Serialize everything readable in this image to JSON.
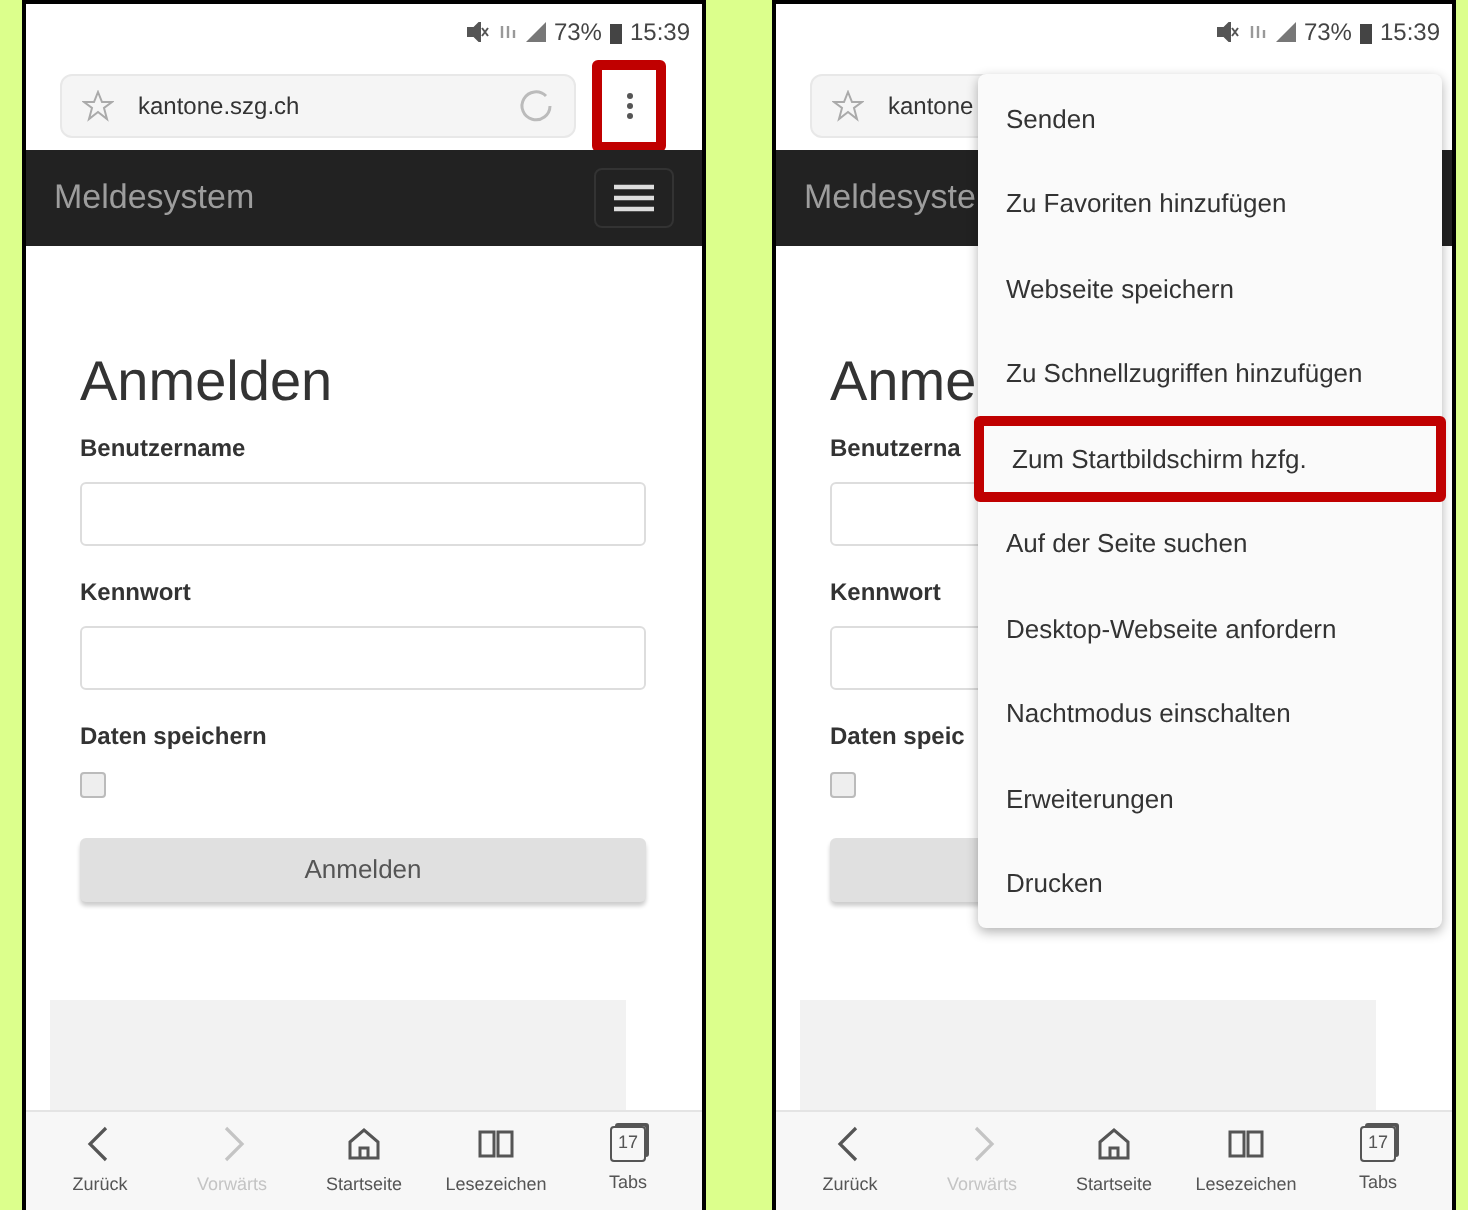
{
  "screens": [
    {
      "status": {
        "battery": "73%",
        "time": "15:39"
      },
      "address_bar": {
        "url": "kantone.szg.ch",
        "menu_button": {
          "highlighted": true
        }
      },
      "navbar": {
        "title": "Meldesystem",
        "menu_toggle": true
      },
      "login": {
        "heading": "Anmelden",
        "fields": [
          {
            "label": "Benutzername"
          },
          {
            "label": "Kennwort"
          }
        ],
        "checkbox": {
          "label": "Daten speichern",
          "checked": false
        },
        "button": {
          "label": "Anmelden"
        }
      },
      "bottom_nav": [
        {
          "label": "Zurück",
          "disabled": false
        },
        {
          "label": "Vorwärts",
          "disabled": true
        },
        {
          "label": "Startseite",
          "disabled": false
        },
        {
          "label": "Lesezeichen",
          "disabled": false
        },
        {
          "label": "Tabs",
          "badge": "17",
          "disabled": false
        }
      ]
    },
    {
      "status": {
        "battery": "73%",
        "time": "15:39"
      },
      "address_bar": {
        "url": "kantone"
      },
      "navbar": {
        "title": "Meldesyste",
        "menu_toggle": false
      },
      "login": {
        "heading": "Anme",
        "fields": [
          {
            "label": "Benutzerna"
          },
          {
            "label": "Kennwort"
          }
        ],
        "checkbox": {
          "label": "Daten speic",
          "checked": false
        }
      },
      "menu": {
        "items": [
          {
            "label": "Senden",
            "highlighted": false
          },
          {
            "label": "Zu Favoriten hinzufügen",
            "highlighted": false
          },
          {
            "label": "Webseite speichern",
            "highlighted": false
          },
          {
            "label": "Zu Schnellzugriffen hinzufügen",
            "highlighted": false
          },
          {
            "label": "Zum Startbildschirm hzfg.",
            "highlighted": true
          },
          {
            "label": "Auf der Seite suchen",
            "highlighted": false
          },
          {
            "label": "Desktop-Webseite anfordern",
            "highlighted": false
          },
          {
            "label": "Nachtmodus einschalten",
            "highlighted": false
          },
          {
            "label": "Erweiterungen",
            "highlighted": false
          },
          {
            "label": "Drucken",
            "highlighted": false
          }
        ]
      },
      "bottom_nav": [
        {
          "label": "Zurück",
          "disabled": false
        },
        {
          "label": "Vorwärts",
          "disabled": true
        },
        {
          "label": "Startseite",
          "disabled": false
        },
        {
          "label": "Lesezeichen",
          "disabled": false
        },
        {
          "label": "Tabs",
          "badge": "17",
          "disabled": false
        }
      ]
    }
  ]
}
